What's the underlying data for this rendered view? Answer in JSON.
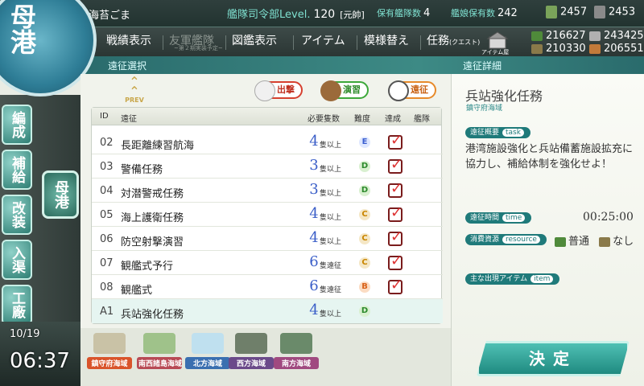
{
  "header": {
    "player_name": "海苔ごま",
    "hq_label": "艦隊司令部Level.",
    "hq_level": "120",
    "rank": "[元帥]",
    "fleet_label": "保有艦隊数",
    "fleet_value": "4",
    "girls_label": "艦娘保有数",
    "girls_value": "242",
    "buckets": "2457",
    "dev_materials": "2453"
  },
  "menu": {
    "record": "戦績表示",
    "friend_fleet": "友軍艦隊",
    "friend_fleet_note": "~第２期実装予定~",
    "library": "図鑑表示",
    "items": "アイテム",
    "furniture": "模様替え",
    "quests": "任務",
    "quests_sub": "(クエスト)",
    "item_store": "アイテム屋",
    "fuel": "216627",
    "ammo": "210330",
    "steel": "243425",
    "bauxite": "206551"
  },
  "section": {
    "left": "遠征選択",
    "right": "遠征詳細"
  },
  "nav": {
    "port": "母港",
    "organize": "編成",
    "supply": "補給",
    "remodel": "改装",
    "dock": "入渠",
    "arsenal": "工廠"
  },
  "clock": {
    "date": "10/19",
    "time": "06:37"
  },
  "tabs": {
    "prev": "PREV",
    "sortie": "出撃",
    "practice": "演習",
    "expedition": "遠征"
  },
  "list": {
    "headers": {
      "id": "ID",
      "name": "遠征",
      "count": "必要隻数",
      "difficulty": "難度",
      "achieved": "達成",
      "ships": "艦隊"
    },
    "rows": [
      {
        "id": "02",
        "name": "長距離練習航海",
        "count": "4",
        "unit": "隻以上",
        "difficulty": "E",
        "achieved": true
      },
      {
        "id": "03",
        "name": "警備任務",
        "count": "3",
        "unit": "隻以上",
        "difficulty": "D",
        "achieved": true
      },
      {
        "id": "04",
        "name": "対潜警戒任務",
        "count": "3",
        "unit": "隻以上",
        "difficulty": "D",
        "achieved": true
      },
      {
        "id": "05",
        "name": "海上護衛任務",
        "count": "4",
        "unit": "隻以上",
        "difficulty": "C",
        "achieved": true
      },
      {
        "id": "06",
        "name": "防空射撃演習",
        "count": "4",
        "unit": "隻以上",
        "difficulty": "C",
        "achieved": true
      },
      {
        "id": "07",
        "name": "観艦式予行",
        "count": "6",
        "unit": "隻遠征",
        "difficulty": "C",
        "achieved": true
      },
      {
        "id": "08",
        "name": "観艦式",
        "count": "6",
        "unit": "隻遠征",
        "difficulty": "B",
        "achieved": true
      },
      {
        "id": "A1",
        "name": "兵站強化任務",
        "count": "4",
        "unit": "隻以上",
        "difficulty": "D",
        "achieved": false
      }
    ]
  },
  "areas": [
    {
      "label": "鎮守府海域",
      "color": "#d9542b"
    },
    {
      "label": "南西諸島海域",
      "color": "#b84a55"
    },
    {
      "label": "北方海域",
      "color": "#3a6fb0"
    },
    {
      "label": "西方海域",
      "color": "#6b4a8a"
    },
    {
      "label": "南方海域",
      "color": "#a04a80"
    }
  ],
  "detail": {
    "title": "兵站強化任務",
    "area": "鎮守府海域",
    "overview_label": "遠征概要",
    "overview_en": "task",
    "description": "港湾施設強化と兵站備蓄施設拡充に協力し、補給体制を強化せよ！",
    "time_label": "遠征時間",
    "time_en": "time",
    "time_value": "00:25:00",
    "resource_label": "消費資源",
    "resource_en": "resource",
    "fuel_use": "普通",
    "ammo_use": "なし",
    "items_label": "主な出現アイテム",
    "items_en": "item",
    "decide": "決定"
  }
}
